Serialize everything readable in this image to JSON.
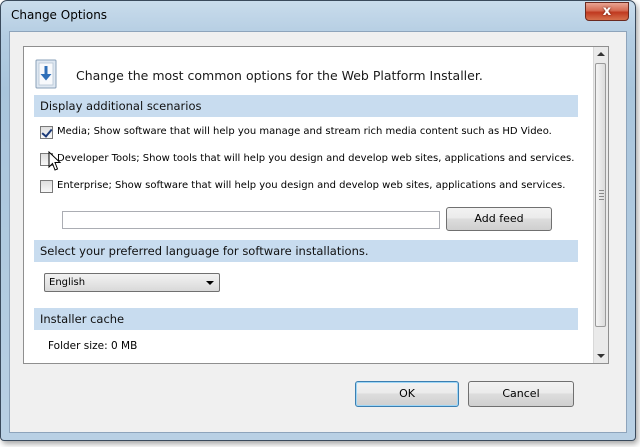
{
  "window": {
    "title": "Change Options",
    "close_glyph": "x"
  },
  "header": {
    "icon": "installer-icon",
    "text": "Change the most common options for the Web Platform Installer."
  },
  "scenarios": {
    "section_title": "Display additional scenarios",
    "items": [
      {
        "label": "Media; Show software that will help you manage and stream rich media content such as HD Video.",
        "checked": true
      },
      {
        "label": "Developer Tools; Show tools that will help you design and develop web sites, applications and services.",
        "checked": false
      },
      {
        "label": "Enterprise; Show software that will help you design and develop web sites, applications and services.",
        "checked": false
      }
    ],
    "feed_input_value": "",
    "add_feed_label": "Add feed"
  },
  "language": {
    "section_title": "Select your preferred language for software installations.",
    "selected": "English"
  },
  "cache": {
    "section_title": "Installer cache",
    "folder_size": "Folder size: 0 MB"
  },
  "buttons": {
    "ok_label": "OK",
    "cancel_label": "Cancel"
  },
  "colors": {
    "section_bar": "#c8dcef",
    "title_gradient": "#b4cde2",
    "close_button": "#c0391f"
  }
}
